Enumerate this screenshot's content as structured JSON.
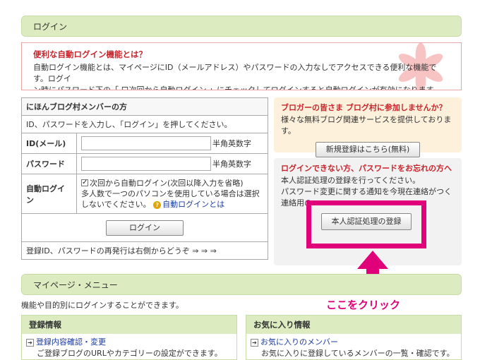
{
  "login_bar": {
    "title": "ログイン"
  },
  "notice": {
    "title": "便利な自動ログイン機能とは？",
    "line1": "自動ログイン機能とは、マイページにID（メールアドレス）やパスワードの入力なしでアクセスできる便利な機能です。ログイ",
    "line2": "ン時にパスワード下の「 口次回から自動ログイン 」にチェックしてログインすると自動ログインが有効になります。"
  },
  "login_form": {
    "header": "にほんブログ村メンバーの方",
    "instruction": "ID、パスワードを入力し、「ログイン」を押してください。",
    "id_label": "ID(メール)",
    "id_hint": "半角英数字",
    "password_label": "パスワード",
    "password_hint": "半角英数字",
    "auto_label": "自動ログイン",
    "auto_checkbox_text": "次回から自動ログイン(次回以降入力を省略)",
    "auto_note": "多人数で一つのパソコンを使用している場合は選択しないでください。",
    "auto_link": "自動ログインとは",
    "login_button": "ログイン",
    "footer": "登録ID、パスワードの再発行は右側からどうぞ ⇒ ⇒ ⇒"
  },
  "blogger_box": {
    "title": "ブロガーの皆さま ブログ村に参加しませんか？",
    "text": "様々な無料ブログ関連サービスを提供しております。",
    "button": "新規登録はこちら(無料)"
  },
  "recovery_box": {
    "title": "ログインできない方、パスワードをお忘れの方へ",
    "line1": "本人認証処理の登録を行ってください。",
    "line2": "パスワード変更に関する通知を今現在連絡がつく",
    "line3": "連絡用の",
    "button": "本人認証処理の登録"
  },
  "annotation": {
    "label": "ここをクリック",
    "color": "#e0007a"
  },
  "mypage_bar": {
    "title": "マイページ・メニュー"
  },
  "mypage_desc": "機能や目的別にログインすることができます。",
  "registration_info": {
    "title": "登録情報",
    "link": "登録内容確認・変更",
    "desc": "ご登録ブログのURLやカテゴリーの設定ができます。"
  },
  "favorites_info": {
    "title": "お気に入り情報",
    "link": "お気に入りのメンバー",
    "desc": "お気に入りに登録しているメンバーの一覧・確認です。"
  },
  "colors": {
    "accent_red": "#c8242b",
    "highlight_pink": "#e0007a",
    "bar_green": "#dcebc0",
    "link_blue": "#1a3a9e"
  },
  "icons": {
    "notice_decoration": "star-icon",
    "info_link": "arrow-right-icon",
    "help": "question-icon"
  }
}
